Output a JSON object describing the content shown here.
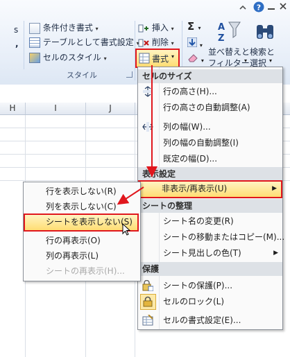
{
  "ribbon": {
    "cells_partial_1": "s",
    "cells_partial_2": ",",
    "conditional_format": "条件付き書式",
    "format_as_table": "テーブルとして書式設定",
    "cell_styles": "セルのスタイル",
    "styles_group": "スタイル",
    "insert": "挿入",
    "delete": "削除",
    "format": "書式",
    "sigma": "Σ",
    "sort_filter_line1": "並べ替えと",
    "sort_filter_line2": "フィルター",
    "find_select_line1": "検索と",
    "find_select_line2": "選択"
  },
  "columns": [
    "H",
    "I",
    "J"
  ],
  "format_menu": {
    "cell_size_header": "セルのサイズ",
    "row_height": "行の高さ(H)...",
    "autofit_row": "行の高さの自動調整(A)",
    "column_width": "列の幅(W)...",
    "autofit_column": "列の幅の自動調整(I)",
    "default_width": "既定の幅(D)...",
    "visibility_header": "表示設定",
    "hide_unhide": "非表示/再表示(U)",
    "organize_header": "シートの整理",
    "rename_sheet": "シート名の変更(R)",
    "move_copy_sheet": "シートの移動またはコピー(M)...",
    "tab_color": "シート見出しの色(T)",
    "protection_header": "保護",
    "protect_sheet": "シートの保護(P)...",
    "lock_cell": "セルのロック(L)",
    "format_cells": "セルの書式設定(E)..."
  },
  "submenu": {
    "hide_rows": "行を表示しない(R)",
    "hide_columns": "列を表示しない(C)",
    "hide_sheet": "シートを表示しない(S)",
    "unhide_rows": "行の再表示(O)",
    "unhide_columns": "列の再表示(L)",
    "unhide_sheet": "シートの再表示(H)..."
  },
  "colors": {
    "highlight": "#ffdd73",
    "annotation_red": "#e0161d",
    "help_blue": "#2e6ec4"
  }
}
